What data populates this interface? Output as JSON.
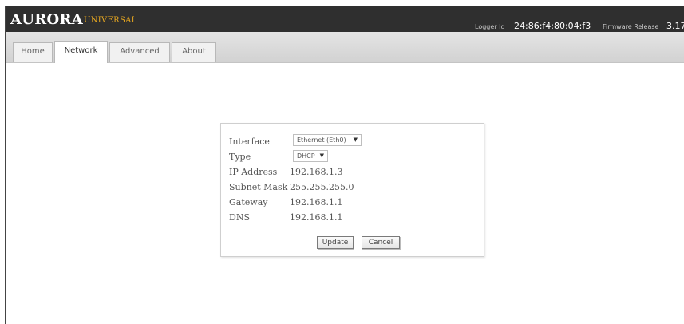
{
  "header": {
    "brand": "AURORA",
    "brand_sub": "UNIVERSAL",
    "logger_id_label": "Logger Id",
    "logger_id_value": "24:86:f4:80:04:f3",
    "firmware_label": "Firmware Release",
    "firmware_value": "3.17"
  },
  "tabs": [
    {
      "label": "Home",
      "active": false
    },
    {
      "label": "Network",
      "active": true
    },
    {
      "label": "Advanced",
      "active": false
    },
    {
      "label": "About",
      "active": false
    }
  ],
  "form": {
    "interface_label": "Interface",
    "interface_value": "Ethernet (Eth0)",
    "type_label": "Type",
    "type_value": "DHCP",
    "ip_label": "IP Address",
    "ip_value": "192.168.1.3",
    "subnet_label": "Subnet Mask",
    "subnet_value": "255.255.255.0",
    "gateway_label": "Gateway",
    "gateway_value": "192.168.1.1",
    "dns_label": "DNS",
    "dns_value": "192.168.1.1",
    "update_label": "Update",
    "cancel_label": "Cancel"
  },
  "colors": {
    "header_bg": "#2f2f2f",
    "brand_sub": "#e8a820",
    "highlight_underline": "#d64545"
  }
}
